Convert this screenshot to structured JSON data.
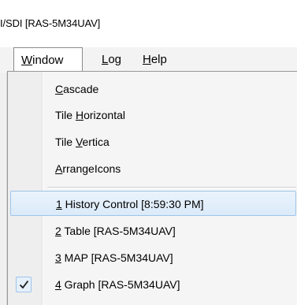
{
  "window": {
    "title_fragment": "I/SDI [RAS-5M34UAV]"
  },
  "menubar": {
    "items": [
      {
        "label": "Window",
        "mnemonic": "W",
        "active": true
      },
      {
        "label": "Log",
        "mnemonic": "L",
        "active": false
      },
      {
        "label": "Help",
        "mnemonic": "H",
        "active": false
      }
    ]
  },
  "window_menu": {
    "arrange": [
      {
        "pre": "",
        "mn": "C",
        "post": "ascade"
      },
      {
        "pre": "Tile ",
        "mn": "H",
        "post": "orizontal"
      },
      {
        "pre": "Tile ",
        "mn": "V",
        "post": "ertica"
      },
      {
        "pre": "",
        "mn": "A",
        "post": "rrangeIcons"
      }
    ],
    "windows": [
      {
        "mn": "1",
        "post": " History Control [8:59:30 PM]",
        "highlighted": true,
        "checked": false
      },
      {
        "mn": "2",
        "post": " Table [RAS-5M34UAV]",
        "highlighted": false,
        "checked": false
      },
      {
        "mn": "3",
        "post": " MAP [RAS-5M34UAV]",
        "highlighted": false,
        "checked": false
      },
      {
        "mn": "4",
        "post": " Graph [RAS-5M34UAV]",
        "highlighted": false,
        "checked": true
      }
    ]
  }
}
